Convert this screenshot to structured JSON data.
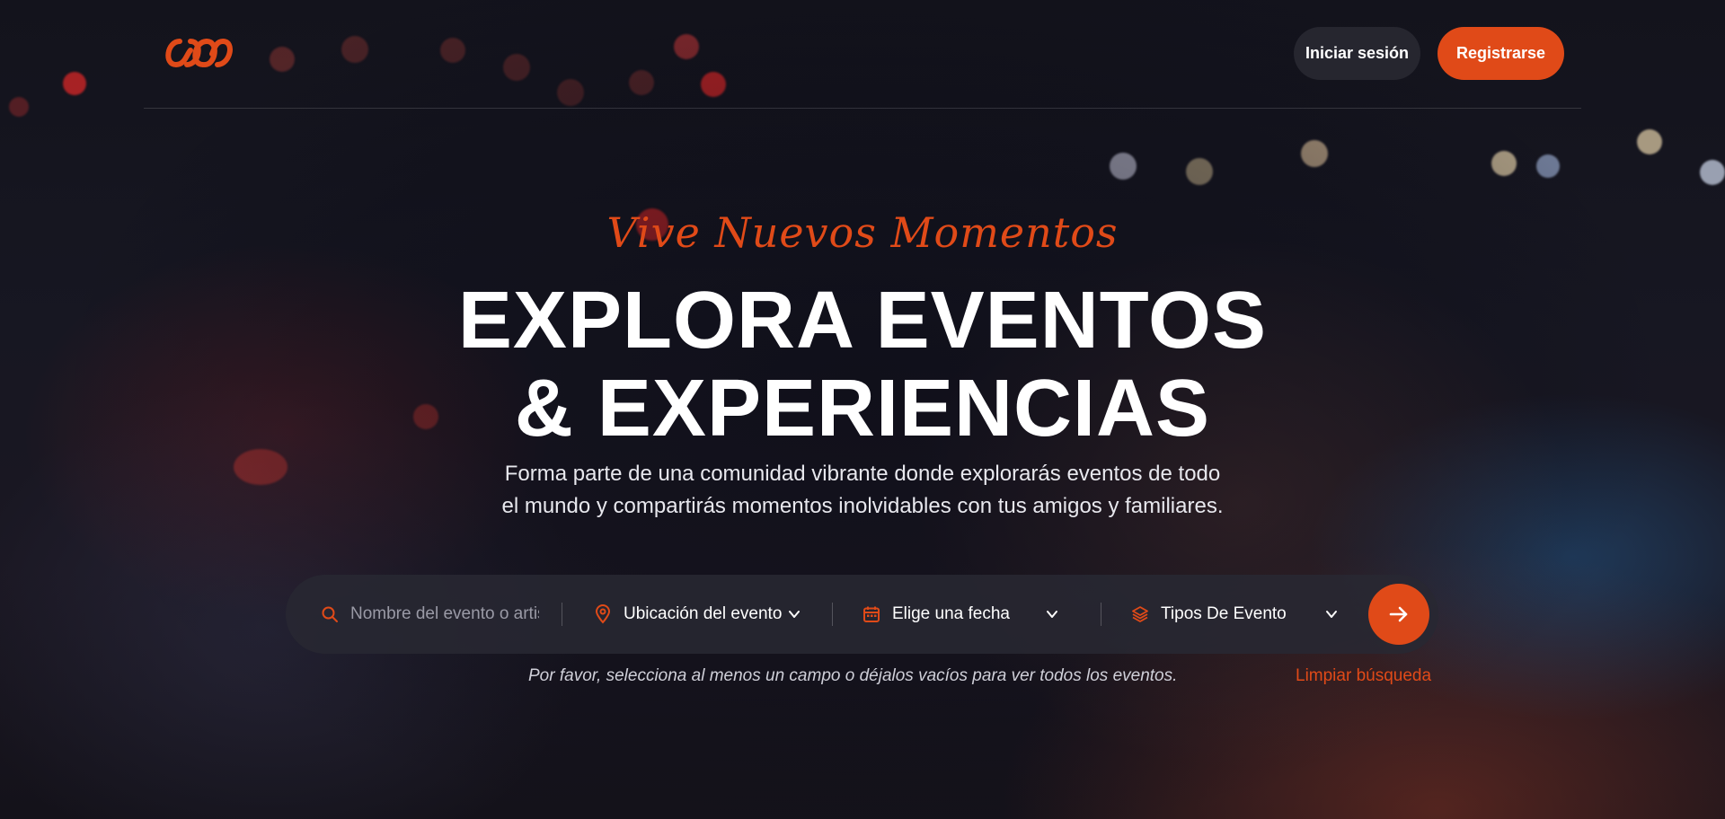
{
  "header": {
    "login_label": "Iniciar sesión",
    "register_label": "Registrarse"
  },
  "hero": {
    "tagline": "Vive Nuevos Momentos",
    "title_line1": "EXPLORA EVENTOS",
    "title_line2": "& EXPERIENCIAS",
    "subtitle_line1": "Forma parte de una comunidad vibrante donde explorarás eventos de todo",
    "subtitle_line2": "el mundo y compartirás momentos inolvidables con tus amigos y familiares."
  },
  "search": {
    "name_placeholder": "Nombre del evento o artista",
    "location_label": "Ubicación del evento",
    "date_label": "Elige una fecha",
    "type_label": "Tipos De Evento",
    "hint": "Por favor, selecciona al menos un campo o déjalos vacíos para ver todos los eventos.",
    "clear_label": "Limpiar búsqueda"
  },
  "colors": {
    "accent": "#e04a18",
    "background": "#14141c",
    "search_bar": "#282832"
  },
  "icons": {
    "logo": "infinity-links-logo",
    "search": "search-icon",
    "location": "map-pin-icon",
    "date": "calendar-icon",
    "type": "layers-icon",
    "dropdown": "chevron-down-icon",
    "submit": "arrow-right-icon"
  }
}
